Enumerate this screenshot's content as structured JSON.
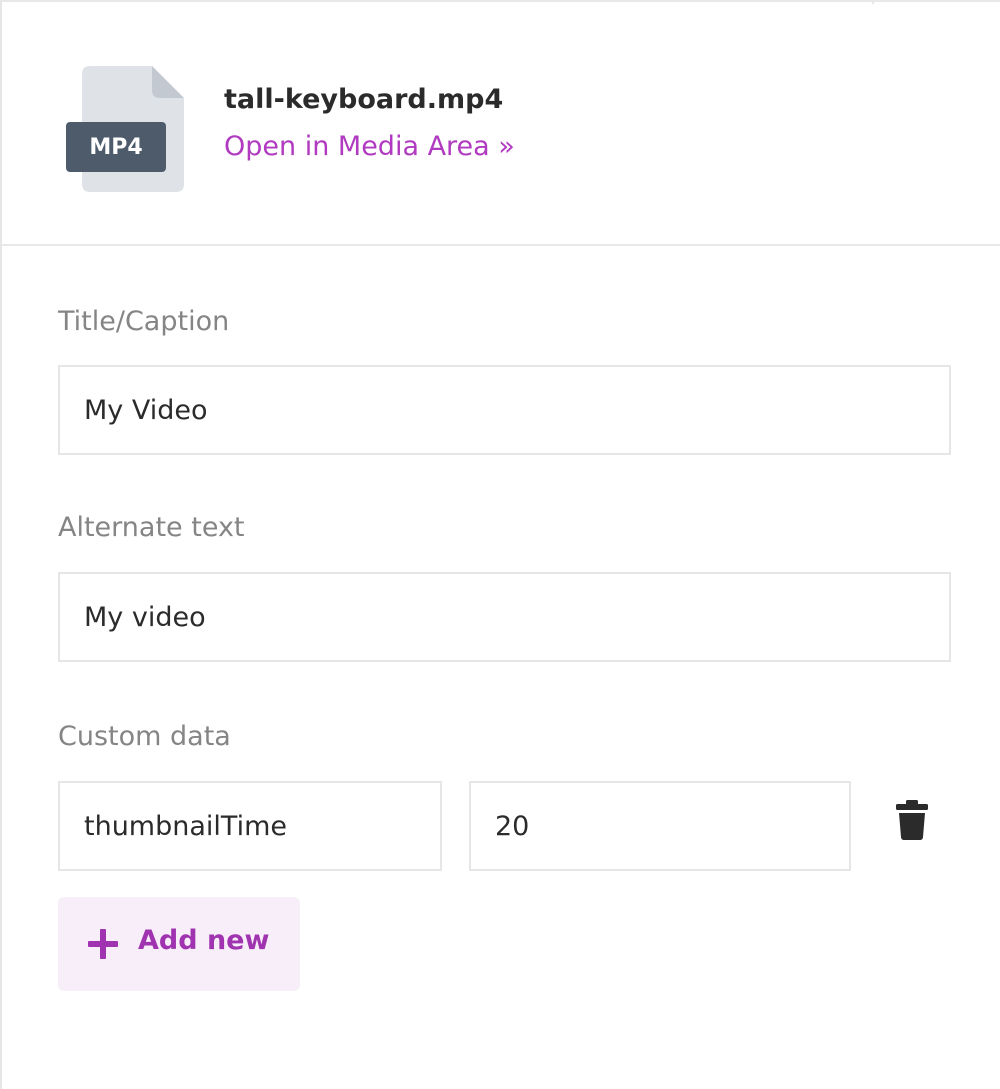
{
  "file": {
    "type_badge": "MP4",
    "name": "tall-keyboard.mp4",
    "open_link": "Open in Media Area »"
  },
  "form": {
    "title_label": "Title/Caption",
    "title_value": "My Video",
    "alt_label": "Alternate text",
    "alt_value": "My video",
    "custom_label": "Custom data",
    "custom_rows": [
      {
        "key": "thumbnailTime",
        "value": "20"
      }
    ],
    "add_label": "Add new"
  },
  "icons": {
    "file": "file-document-icon",
    "delete": "trash-icon",
    "add": "plus-icon"
  },
  "colors": {
    "accent": "#b03ac0",
    "add_button_bg": "#f8eef9",
    "badge_bg": "#4d5b6b",
    "file_body": "#dfe3e8",
    "file_fold": "#c3c9d0"
  }
}
